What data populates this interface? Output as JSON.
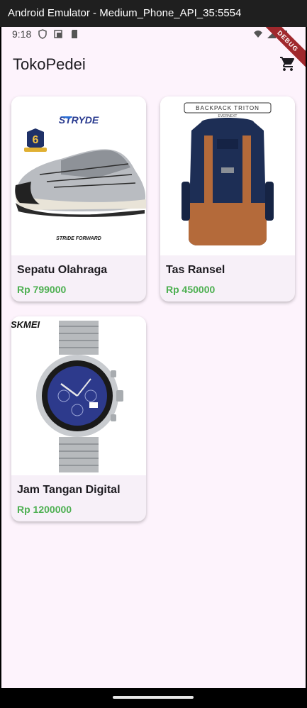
{
  "window": {
    "title": "Android Emulator - Medium_Phone_API_35:5554"
  },
  "status_bar": {
    "time": "9:18",
    "debug_banner": "DEBUG"
  },
  "app_bar": {
    "title": "TokoPedei",
    "cart_icon": "shopping-cart-icon"
  },
  "products": [
    {
      "name": "Sepatu Olahraga",
      "price": "Rp 799000",
      "image": {
        "brand": "STRYDE",
        "tagline": "STRIDE FORWARD",
        "badge": "6"
      }
    },
    {
      "name": "Tas Ransel",
      "price": "Rp 450000",
      "image": {
        "title": "BACKPACK TRITON",
        "brand": "EVERNEXT"
      }
    },
    {
      "name": "Jam Tangan Digital",
      "price": "Rp 1200000",
      "image": {
        "brand": "SKMEI"
      }
    }
  ],
  "colors": {
    "price": "#4caf50",
    "background": "#fdf3fc",
    "card": "#f7f0f8"
  }
}
